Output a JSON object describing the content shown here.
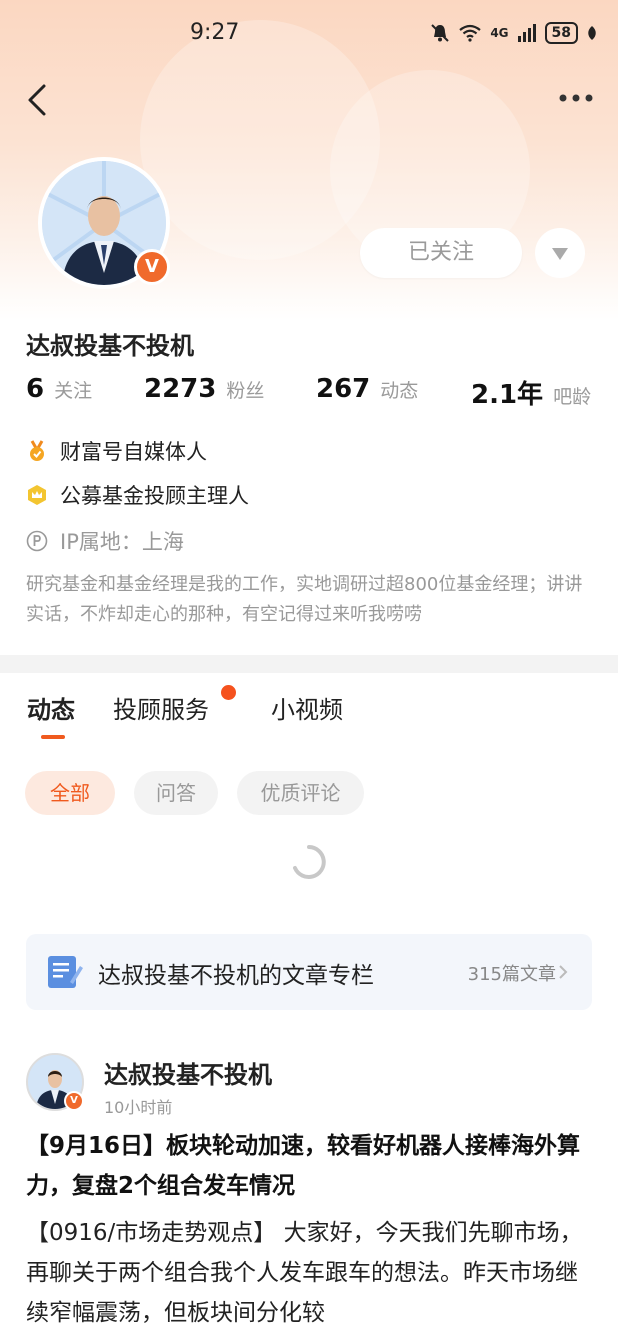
{
  "status_bar": {
    "time": "9:27",
    "signal_text": "4G",
    "battery": "58"
  },
  "nav": {
    "back_icon": "back-arrow-icon",
    "more_icon": "more-dots-icon"
  },
  "profile": {
    "name": "达叔投基不投机",
    "verified_badge": "V",
    "follow_button": "已关注",
    "stats": [
      {
        "value": "6",
        "label": "关注"
      },
      {
        "value": "2273",
        "label": "粉丝"
      },
      {
        "value": "267",
        "label": "动态"
      },
      {
        "value": "2.1年",
        "label": "吧龄"
      }
    ],
    "tags": [
      {
        "icon": "medal-icon",
        "text": "财富号自媒体人"
      },
      {
        "icon": "crown-badge-icon",
        "text": "公募基金投顾主理人"
      }
    ],
    "ip_location": "IP属地：上海",
    "bio": "研究基金和基金经理是我的工作，实地调研过超800位基金经理；讲讲实话，不炸却走心的那种，有空记得过来听我唠唠"
  },
  "tabs": [
    {
      "label": "动态",
      "active": true
    },
    {
      "label": "投顾服务",
      "active": false,
      "has_dot": true
    },
    {
      "label": "小视频",
      "active": false
    }
  ],
  "filters": [
    {
      "label": "全部",
      "active": true
    },
    {
      "label": "问答",
      "active": false
    },
    {
      "label": "优质评论",
      "active": false
    }
  ],
  "column": {
    "title": "达叔投基不投机的文章专栏",
    "count": "315篇文章"
  },
  "post": {
    "author": "达叔投基不投机",
    "time": "10小时前",
    "title": "【9月16日】板块轮动加速，较看好机器人接棒海外算力，复盘2个组合发车情况",
    "body": "【0916/市场走势观点】 大家好，今天我们先聊市场，再聊关于两个组合我个人发车跟车的想法。昨天市场继续窄幅震荡，但板块间分化较"
  },
  "colors": {
    "accent": "#f05a1e",
    "badge": "#f06a2c",
    "header_bg": "#fbd7c1"
  }
}
